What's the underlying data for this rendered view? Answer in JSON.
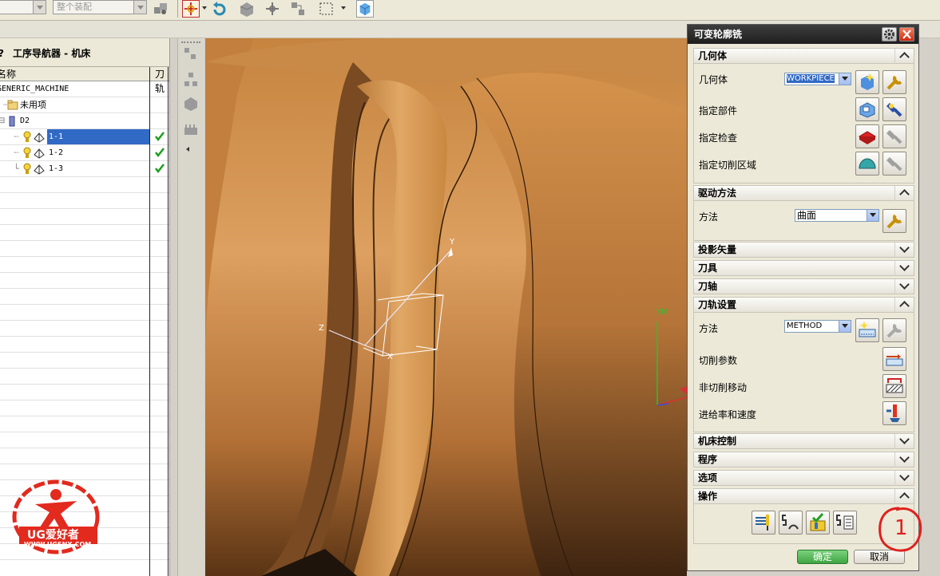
{
  "toolbar": {
    "combo1_value": "",
    "combo2_value": "整个装配"
  },
  "navigator": {
    "title": "工序导航器 - 机床",
    "col_name": "名称",
    "col_tool": "刀轨",
    "rows": [
      {
        "label": "GENERIC_MACHINE"
      },
      {
        "label": "未用项"
      },
      {
        "label": "D2"
      },
      {
        "label": "1-1",
        "tool_ok": true,
        "selected": true
      },
      {
        "label": "1-2",
        "tool_ok": true
      },
      {
        "label": "1-3",
        "tool_ok": true
      }
    ]
  },
  "viewport": {
    "axis_x": "X",
    "axis_y": "Y",
    "axis_z": "Z",
    "axis_ym": "YM"
  },
  "watermark": {
    "brand": "UG爱好者",
    "url": "WWW.UGSNX.COM"
  },
  "dialog": {
    "title": "可变轮廓铣",
    "sections": {
      "geometry": "几何体",
      "drive": "驱动方法",
      "projection": "投影矢量",
      "tool": "刀具",
      "tool_axis": "刀轴",
      "path_settings": "刀轨设置",
      "machine_control": "机床控制",
      "program": "程序",
      "options": "选项",
      "actions": "操作"
    },
    "geometry": {
      "label": "几何体",
      "value": "WORKPIECE",
      "part": "指定部件",
      "check": "指定检查",
      "cut_area": "指定切削区域"
    },
    "drive": {
      "label": "方法",
      "value": "曲面"
    },
    "path": {
      "label": "方法",
      "value": "METHOD",
      "cut_params": "切削参数",
      "non_cut": "非切削移动",
      "feeds": "进给率和速度"
    },
    "ok": "确定",
    "cancel": "取消"
  },
  "annotation": {
    "mark": "1"
  },
  "colors": {
    "selection": "#316ac5",
    "part_orange": "#c98a45",
    "ok_green": "#3fa542",
    "annotation_red": "#e0201c"
  }
}
